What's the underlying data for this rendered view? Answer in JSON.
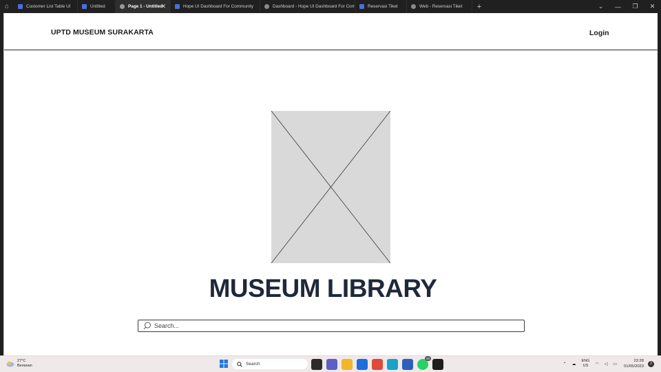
{
  "browser": {
    "tabs": [
      {
        "label": "Customer List Table UI",
        "icon": "figma-file-icon",
        "width": 93
      },
      {
        "label": "Untitled",
        "icon": "figma-file-icon",
        "width": 55
      },
      {
        "label": "Page 1 - Untitled",
        "icon": "play-icon",
        "active": true,
        "width": 80
      },
      {
        "label": "Hope UI Dashboard For Community",
        "icon": "figma-file-icon",
        "width": 130
      },
      {
        "label": "Dashboard - Hope UI Dashboard For Com",
        "icon": "globe-icon",
        "width": 138
      },
      {
        "label": "Reservasi Tiket",
        "icon": "figma-file-icon",
        "width": 75
      },
      {
        "label": "Web - Reservasi Tiket",
        "icon": "globe-icon",
        "width": 95
      }
    ],
    "close_tab_glyph": "✕",
    "new_tab_glyph": "+",
    "window_controls": [
      "⌄",
      "—",
      "❐",
      "✕"
    ]
  },
  "header": {
    "brand": "UPTD MUSEUM SURAKARTA",
    "login_label": "Login"
  },
  "hero": {
    "title": "MUSEUM LIBRARY"
  },
  "search": {
    "placeholder": "Search..."
  },
  "taskbar": {
    "weather_temp": "27°C",
    "weather_desc": "Berawan",
    "search_label": "Search",
    "apps": [
      {
        "name": "file-manager-app",
        "color": "#2b2b2b"
      },
      {
        "name": "teams-app",
        "color": "#5b5fc7"
      },
      {
        "name": "file-explorer-app",
        "color": "#f2b52c"
      },
      {
        "name": "store-app",
        "color": "#1e6fd9"
      },
      {
        "name": "chrome-app",
        "color": "#e04a3a"
      },
      {
        "name": "edge-app",
        "color": "#1aa3c8"
      },
      {
        "name": "word-app",
        "color": "#2b5fb9"
      },
      {
        "name": "whatsapp-app",
        "color": "#25d366"
      },
      {
        "name": "figma-app",
        "color": "#1e1e1e"
      }
    ],
    "whatsapp_badge": "20",
    "lang_top": "ENG",
    "lang_bottom": "US",
    "time": "22:28",
    "date": "01/05/2023",
    "notifications": "2"
  }
}
